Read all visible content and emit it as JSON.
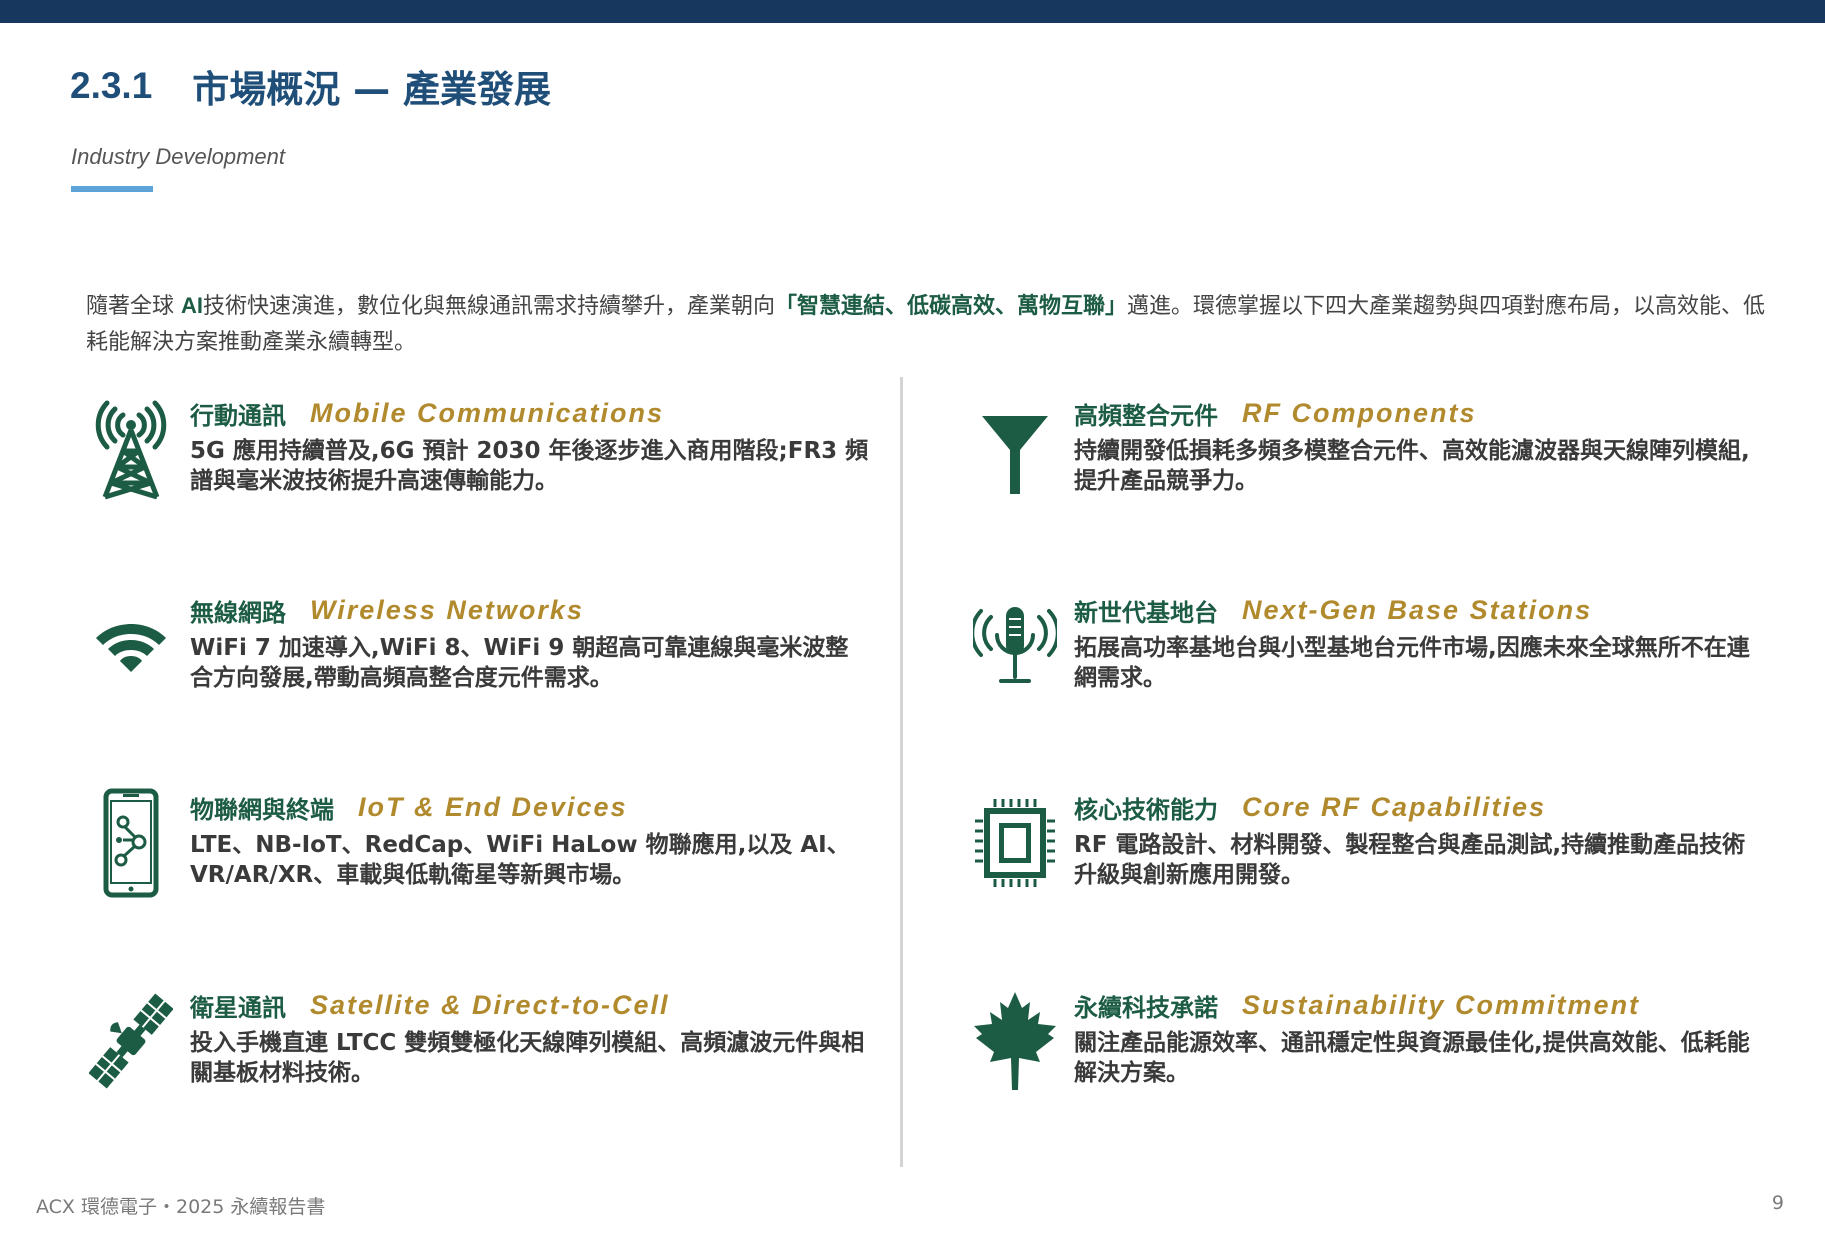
{
  "header": {
    "section_number": "2.3.1",
    "title": "市場概況 — 產業發展",
    "subtitle": "Industry Development"
  },
  "intro": {
    "part1": "隨著全球 ",
    "ai": "AI",
    "part2": "技術快速演進，數位化與無線通訊需求持續攀升，產業朝向",
    "highlight": "「智慧連結、低碳高效、萬物互聯」",
    "part3": "邁進。環德掌握以下四大產業趨勢與四項對應布局，以高效能、低耗能解決方案推動產業永續轉型。"
  },
  "left_column": [
    {
      "icon": "antenna-tower-icon",
      "title_zh": "行動通訊",
      "title_en": "Mobile Communications",
      "description": "5G 應用持續普及,6G 預計 2030 年後逐步進入商用階段;FR3 頻譜與毫米波技術提升高速傳輸能力。"
    },
    {
      "icon": "wifi-icon",
      "title_zh": "無線網路",
      "title_en": "Wireless Networks",
      "description": "WiFi 7 加速導入,WiFi 8、WiFi 9 朝超高可靠連線與毫米波整合方向發展,帶動高頻高整合度元件需求。"
    },
    {
      "icon": "iot-smartphone-icon",
      "title_zh": "物聯網與終端",
      "title_en": "IoT & End Devices",
      "description": "LTE、NB-IoT、RedCap、WiFi HaLow 物聯應用,以及 AI、VR/AR/XR、車載與低軌衛星等新興市場。"
    },
    {
      "icon": "satellite-icon",
      "title_zh": "衛星通訊",
      "title_en": "Satellite & Direct-to-Cell",
      "description": "投入手機直連 LTCC 雙頻雙極化天線陣列模組、高頻濾波元件與相關基板材料技術。"
    }
  ],
  "right_column": [
    {
      "icon": "rf-filter-funnel-icon",
      "title_zh": "高頻整合元件",
      "title_en": "RF Components",
      "description": "持續開發低損耗多頻多模整合元件、高效能濾波器與天線陣列模組,提升產品競爭力。"
    },
    {
      "icon": "broadcast-microphone-icon",
      "title_zh": "新世代基地台",
      "title_en": "Next-Gen Base Stations",
      "description": "拓展高功率基地台與小型基地台元件市場,因應未來全球無所不在連網需求。"
    },
    {
      "icon": "chip-icon",
      "title_zh": "核心技術能力",
      "title_en": "Core RF Capabilities",
      "description": "RF 電路設計、材料開發、製程整合與產品測試,持續推動產品技術升級與創新應用開發。"
    },
    {
      "icon": "maple-leaf-icon",
      "title_zh": "永續科技承諾",
      "title_en": "Sustainability Commitment",
      "description": "關注產品能源效率、通訊穩定性與資源最佳化,提供高效能、低耗能解決方案。"
    }
  ],
  "footer": {
    "report_name": "ACX 環德電子・2025 永續報告書",
    "page_number": "9"
  },
  "colors": {
    "top_bar": "#17375e",
    "title": "#1f4e79",
    "accent_underline": "#5ba3d9",
    "icon_green": "#1d5c44",
    "english_gold": "#b18a2d"
  }
}
